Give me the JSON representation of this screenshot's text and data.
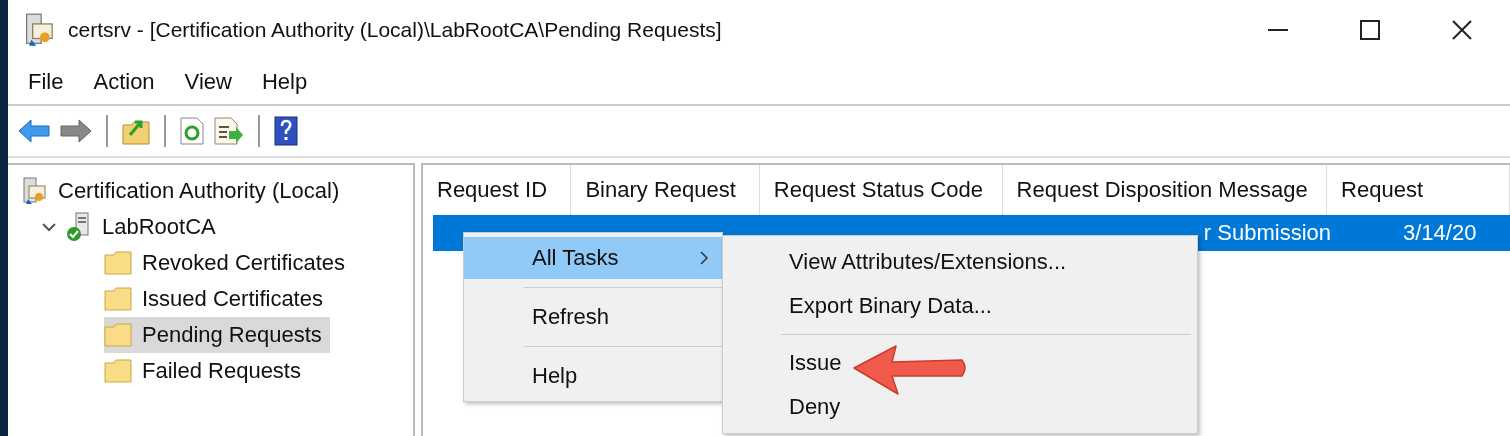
{
  "window": {
    "title": "certsrv - [Certification Authority (Local)\\LabRootCA\\Pending Requests]"
  },
  "menu_bar": [
    "File",
    "Action",
    "View",
    "Help"
  ],
  "toolbar": [
    {
      "kind": "back"
    },
    {
      "kind": "forward"
    },
    {
      "kind": "separator"
    },
    {
      "kind": "up"
    },
    {
      "kind": "separator"
    },
    {
      "kind": "refresh"
    },
    {
      "kind": "export"
    },
    {
      "kind": "separator"
    },
    {
      "kind": "help"
    }
  ],
  "tree": [
    {
      "label": "Certification Authority (Local)",
      "kind": "authority",
      "children": [
        {
          "label": "LabRootCA",
          "kind": "ca",
          "expanded": true,
          "children": [
            {
              "label": "Revoked Certificates",
              "kind": "folder",
              "selected": false
            },
            {
              "label": "Issued Certificates",
              "kind": "folder",
              "selected": false
            },
            {
              "label": "Pending Requests",
              "kind": "folder",
              "selected": true
            },
            {
              "label": "Failed Requests",
              "kind": "folder",
              "selected": false
            }
          ]
        }
      ]
    }
  ],
  "table": {
    "columns": [
      "Request ID",
      "Binary Request",
      "Request Status Code",
      "Request Disposition Message",
      "Request"
    ],
    "rows": [
      {
        "selected": true,
        "cells": [
          "",
          "",
          "",
          "r Submission",
          "3/14/20"
        ]
      }
    ]
  },
  "context_menu": {
    "items": [
      {
        "kind": "submenu",
        "label": "All Tasks",
        "selected": true
      },
      {
        "kind": "separator"
      },
      {
        "kind": "item",
        "label": "Refresh",
        "selected": false
      },
      {
        "kind": "separator"
      },
      {
        "kind": "item",
        "label": "Help",
        "selected": false
      }
    ]
  },
  "submenu": {
    "items": [
      {
        "kind": "item",
        "label": "View Attributes/Extensions..."
      },
      {
        "kind": "item",
        "label": "Export Binary Data..."
      },
      {
        "kind": "separator"
      },
      {
        "kind": "item",
        "label": "Issue"
      },
      {
        "kind": "item",
        "label": "Deny"
      }
    ]
  }
}
